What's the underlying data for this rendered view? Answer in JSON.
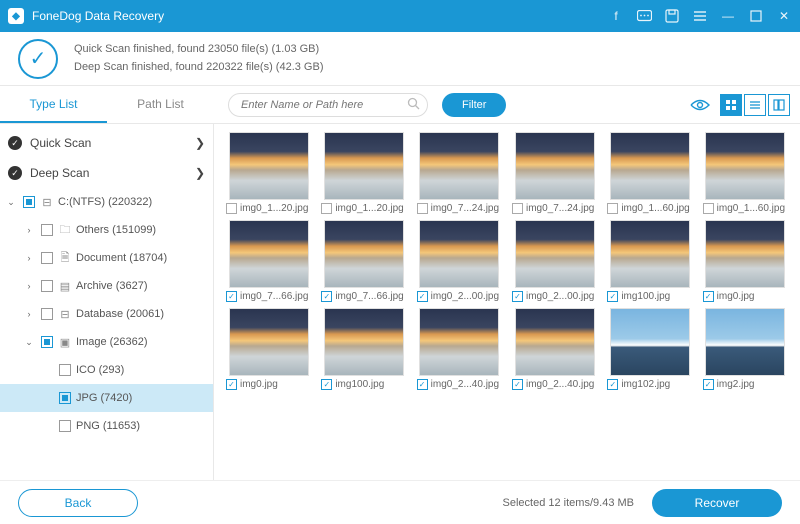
{
  "app": {
    "title": "FoneDog Data Recovery"
  },
  "scan": {
    "quick": "Quick Scan finished, found 23050 file(s) (1.03 GB)",
    "deep": "Deep Scan finished, found 220322 file(s) (42.3 GB)"
  },
  "tabs": {
    "type": "Type List",
    "path": "Path List"
  },
  "search": {
    "placeholder": "Enter Name or Path here"
  },
  "filter": {
    "label": "Filter"
  },
  "sidebar": {
    "quickscan": "Quick Scan",
    "deepscan": "Deep Scan",
    "drive": "C:(NTFS) (220322)",
    "others": "Others (151099)",
    "document": "Document (18704)",
    "archive": "Archive (3627)",
    "database": "Database (20061)",
    "image": "Image (26362)",
    "ico": "ICO (293)",
    "jpg": "JPG (7420)",
    "png": "PNG (11653)"
  },
  "grid": {
    "r1": [
      "img0_1...20.jpg",
      "img0_1...20.jpg",
      "img0_7...24.jpg",
      "img0_7...24.jpg",
      "img0_1...60.jpg",
      "img0_1...60.jpg"
    ],
    "r2": [
      "img0_7...66.jpg",
      "img0_7...66.jpg",
      "img0_2...00.jpg",
      "img0_2...00.jpg",
      "img100.jpg",
      "img0.jpg"
    ],
    "r3": [
      "img0.jpg",
      "img100.jpg",
      "img0_2...40.jpg",
      "img0_2...40.jpg",
      "img102.jpg",
      "img2.jpg"
    ]
  },
  "footer": {
    "back": "Back",
    "selected": "Selected 12 items/9.43 MB",
    "recover": "Recover"
  }
}
